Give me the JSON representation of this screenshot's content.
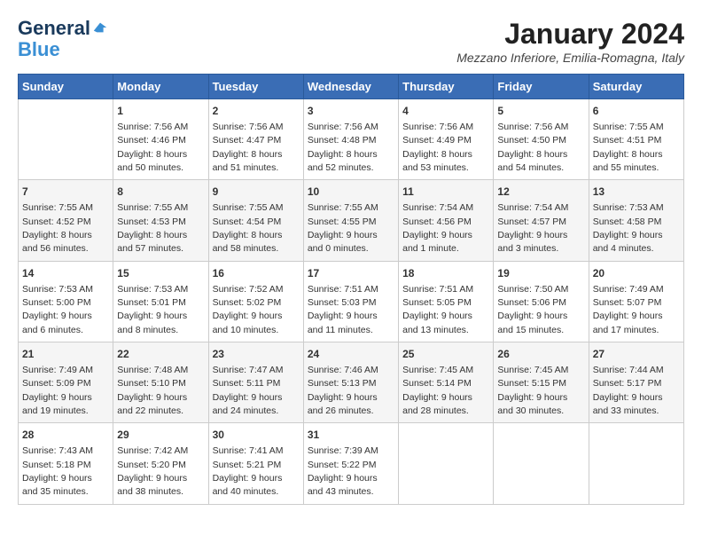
{
  "header": {
    "logo_line1": "General",
    "logo_line2": "Blue",
    "month_title": "January 2024",
    "location": "Mezzano Inferiore, Emilia-Romagna, Italy"
  },
  "days_of_week": [
    "Sunday",
    "Monday",
    "Tuesday",
    "Wednesday",
    "Thursday",
    "Friday",
    "Saturday"
  ],
  "weeks": [
    [
      {
        "day": "",
        "info": ""
      },
      {
        "day": "1",
        "info": "Sunrise: 7:56 AM\nSunset: 4:46 PM\nDaylight: 8 hours\nand 50 minutes."
      },
      {
        "day": "2",
        "info": "Sunrise: 7:56 AM\nSunset: 4:47 PM\nDaylight: 8 hours\nand 51 minutes."
      },
      {
        "day": "3",
        "info": "Sunrise: 7:56 AM\nSunset: 4:48 PM\nDaylight: 8 hours\nand 52 minutes."
      },
      {
        "day": "4",
        "info": "Sunrise: 7:56 AM\nSunset: 4:49 PM\nDaylight: 8 hours\nand 53 minutes."
      },
      {
        "day": "5",
        "info": "Sunrise: 7:56 AM\nSunset: 4:50 PM\nDaylight: 8 hours\nand 54 minutes."
      },
      {
        "day": "6",
        "info": "Sunrise: 7:55 AM\nSunset: 4:51 PM\nDaylight: 8 hours\nand 55 minutes."
      }
    ],
    [
      {
        "day": "7",
        "info": "Sunrise: 7:55 AM\nSunset: 4:52 PM\nDaylight: 8 hours\nand 56 minutes."
      },
      {
        "day": "8",
        "info": "Sunrise: 7:55 AM\nSunset: 4:53 PM\nDaylight: 8 hours\nand 57 minutes."
      },
      {
        "day": "9",
        "info": "Sunrise: 7:55 AM\nSunset: 4:54 PM\nDaylight: 8 hours\nand 58 minutes."
      },
      {
        "day": "10",
        "info": "Sunrise: 7:55 AM\nSunset: 4:55 PM\nDaylight: 9 hours\nand 0 minutes."
      },
      {
        "day": "11",
        "info": "Sunrise: 7:54 AM\nSunset: 4:56 PM\nDaylight: 9 hours\nand 1 minute."
      },
      {
        "day": "12",
        "info": "Sunrise: 7:54 AM\nSunset: 4:57 PM\nDaylight: 9 hours\nand 3 minutes."
      },
      {
        "day": "13",
        "info": "Sunrise: 7:53 AM\nSunset: 4:58 PM\nDaylight: 9 hours\nand 4 minutes."
      }
    ],
    [
      {
        "day": "14",
        "info": "Sunrise: 7:53 AM\nSunset: 5:00 PM\nDaylight: 9 hours\nand 6 minutes."
      },
      {
        "day": "15",
        "info": "Sunrise: 7:53 AM\nSunset: 5:01 PM\nDaylight: 9 hours\nand 8 minutes."
      },
      {
        "day": "16",
        "info": "Sunrise: 7:52 AM\nSunset: 5:02 PM\nDaylight: 9 hours\nand 10 minutes."
      },
      {
        "day": "17",
        "info": "Sunrise: 7:51 AM\nSunset: 5:03 PM\nDaylight: 9 hours\nand 11 minutes."
      },
      {
        "day": "18",
        "info": "Sunrise: 7:51 AM\nSunset: 5:05 PM\nDaylight: 9 hours\nand 13 minutes."
      },
      {
        "day": "19",
        "info": "Sunrise: 7:50 AM\nSunset: 5:06 PM\nDaylight: 9 hours\nand 15 minutes."
      },
      {
        "day": "20",
        "info": "Sunrise: 7:49 AM\nSunset: 5:07 PM\nDaylight: 9 hours\nand 17 minutes."
      }
    ],
    [
      {
        "day": "21",
        "info": "Sunrise: 7:49 AM\nSunset: 5:09 PM\nDaylight: 9 hours\nand 19 minutes."
      },
      {
        "day": "22",
        "info": "Sunrise: 7:48 AM\nSunset: 5:10 PM\nDaylight: 9 hours\nand 22 minutes."
      },
      {
        "day": "23",
        "info": "Sunrise: 7:47 AM\nSunset: 5:11 PM\nDaylight: 9 hours\nand 24 minutes."
      },
      {
        "day": "24",
        "info": "Sunrise: 7:46 AM\nSunset: 5:13 PM\nDaylight: 9 hours\nand 26 minutes."
      },
      {
        "day": "25",
        "info": "Sunrise: 7:45 AM\nSunset: 5:14 PM\nDaylight: 9 hours\nand 28 minutes."
      },
      {
        "day": "26",
        "info": "Sunrise: 7:45 AM\nSunset: 5:15 PM\nDaylight: 9 hours\nand 30 minutes."
      },
      {
        "day": "27",
        "info": "Sunrise: 7:44 AM\nSunset: 5:17 PM\nDaylight: 9 hours\nand 33 minutes."
      }
    ],
    [
      {
        "day": "28",
        "info": "Sunrise: 7:43 AM\nSunset: 5:18 PM\nDaylight: 9 hours\nand 35 minutes."
      },
      {
        "day": "29",
        "info": "Sunrise: 7:42 AM\nSunset: 5:20 PM\nDaylight: 9 hours\nand 38 minutes."
      },
      {
        "day": "30",
        "info": "Sunrise: 7:41 AM\nSunset: 5:21 PM\nDaylight: 9 hours\nand 40 minutes."
      },
      {
        "day": "31",
        "info": "Sunrise: 7:39 AM\nSunset: 5:22 PM\nDaylight: 9 hours\nand 43 minutes."
      },
      {
        "day": "",
        "info": ""
      },
      {
        "day": "",
        "info": ""
      },
      {
        "day": "",
        "info": ""
      }
    ]
  ]
}
